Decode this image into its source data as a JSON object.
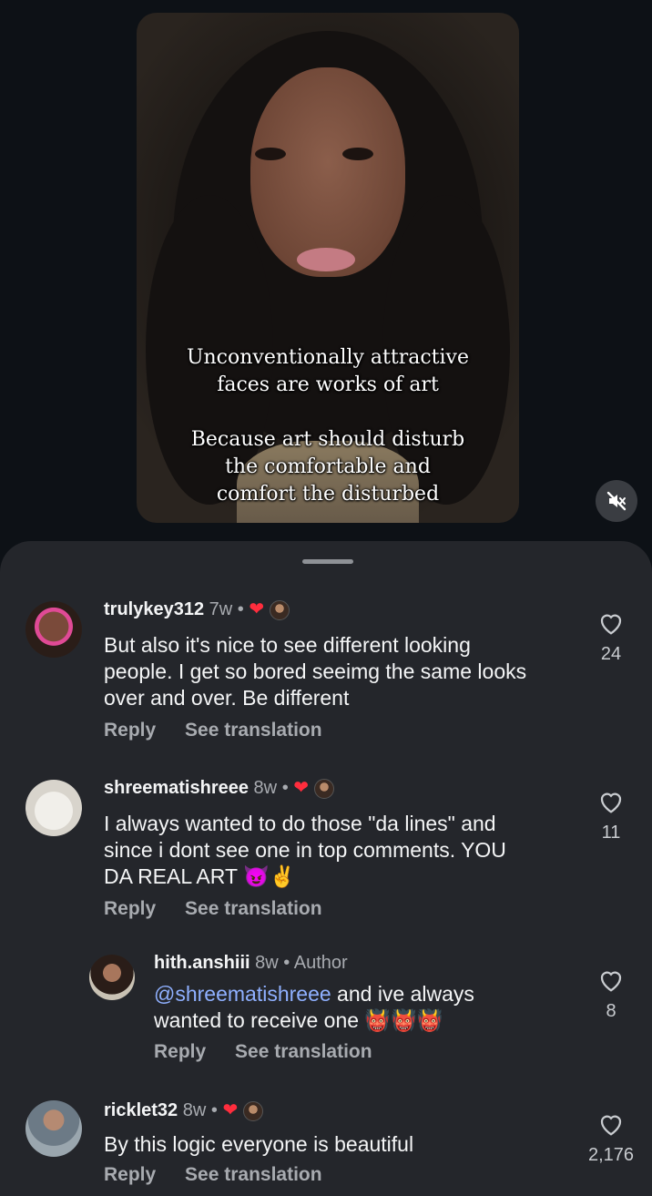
{
  "video": {
    "caption_lines_1": [
      "Unconventionally attractive",
      "faces are works of art"
    ],
    "caption_lines_2": [
      "Because art should disturb",
      "the comfortable and",
      "comfort the disturbed"
    ]
  },
  "comments": [
    {
      "username": "trulykey312",
      "time": "7w",
      "text_lines": [
        "But also it's nice to see different looking",
        "people. I get so bored seeimg the same looks",
        "over and over. Be different"
      ],
      "reply": "Reply",
      "translate": "See translation",
      "likes": "24"
    },
    {
      "username": "shreematishreee",
      "time": "8w",
      "text_lines": [
        "I always wanted to do those \"da lines\" and",
        "since i dont see one in top comments. YOU",
        "DA REAL ART 😈✌️"
      ],
      "reply": "Reply",
      "translate": "See translation",
      "likes": "11"
    },
    {
      "username": "hith.anshiii",
      "time": "8w",
      "author_label": "Author",
      "mention": "@shreematishreee",
      "text_line1_rest": " and ive always",
      "text_line2": "wanted to receive one 👹👹👹",
      "reply": "Reply",
      "translate": "See translation",
      "likes": "8"
    },
    {
      "username": "ricklet32",
      "time": "8w",
      "text_lines": [
        "By this logic everyone is beautiful"
      ],
      "reply": "Reply",
      "translate": "See translation",
      "likes": "2,176"
    }
  ],
  "dot": "•",
  "colors": {
    "sheet": "#24262b",
    "accent_heart": "#ff2d3d",
    "mention": "#8fb0ff"
  },
  "icons": {
    "mute": "speaker-muted-icon",
    "like": "heart-outline-icon",
    "creator_liked": "heart-filled-icon"
  }
}
